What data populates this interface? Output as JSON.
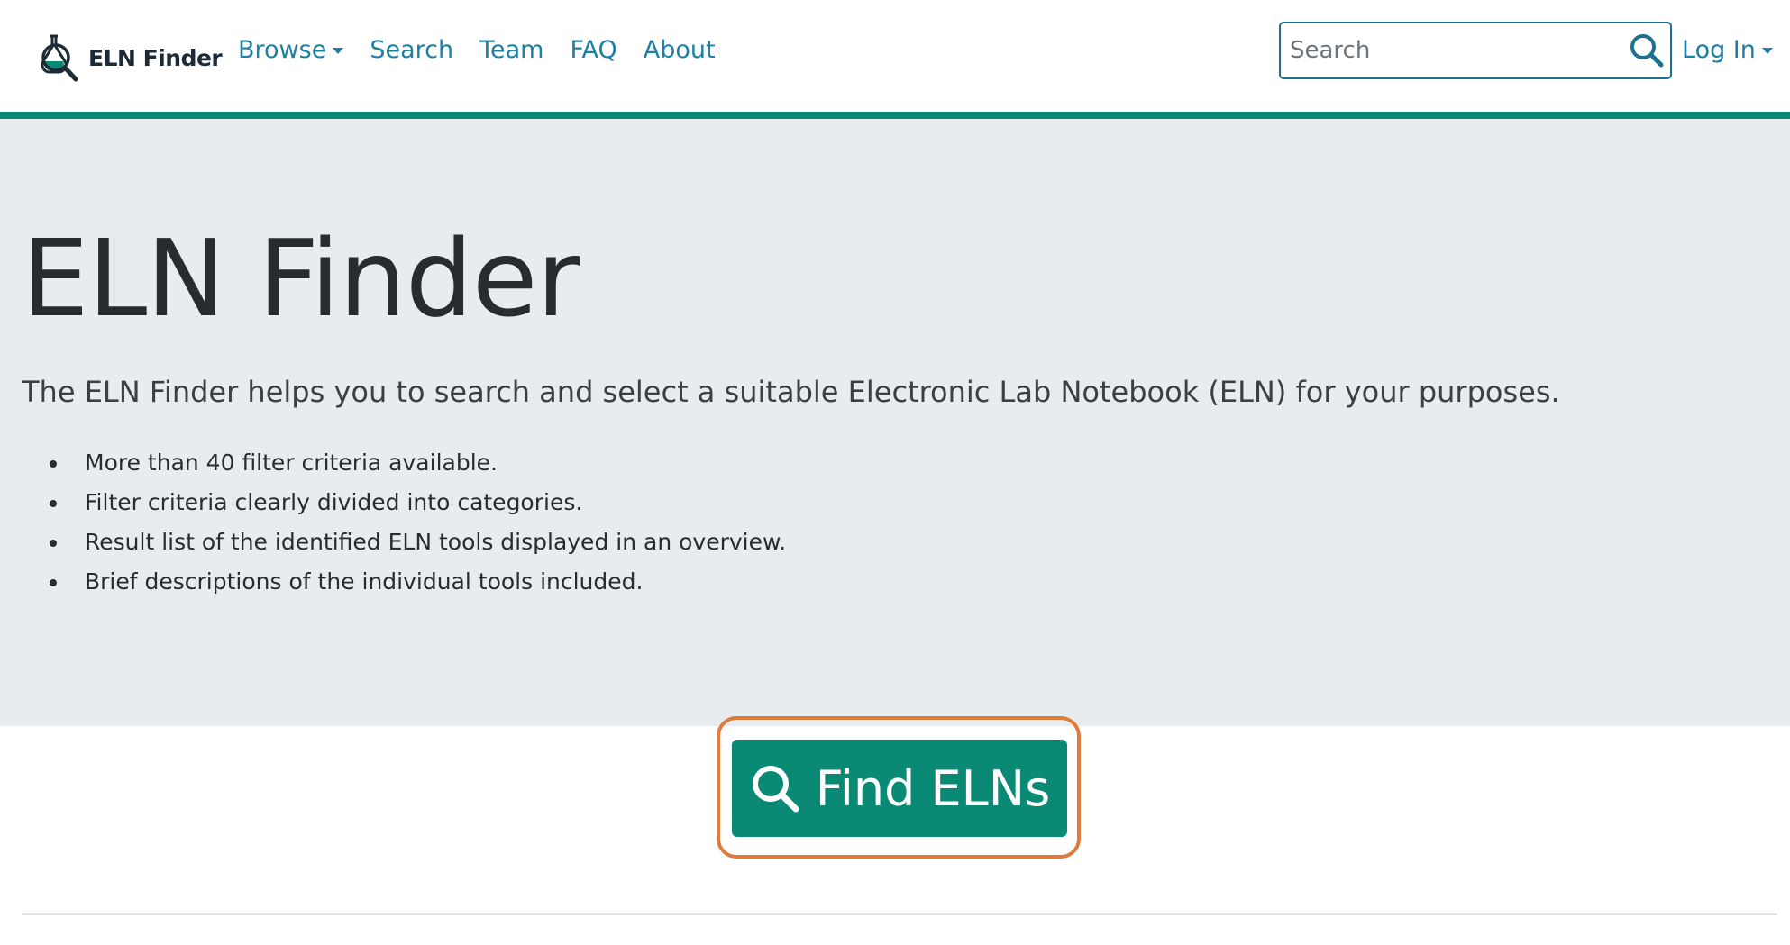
{
  "header": {
    "brand_name": "ELN Finder",
    "nav": [
      {
        "label": "Browse",
        "has_dropdown": true
      },
      {
        "label": "Search",
        "has_dropdown": false
      },
      {
        "label": "Team",
        "has_dropdown": false
      },
      {
        "label": "FAQ",
        "has_dropdown": false
      },
      {
        "label": "About",
        "has_dropdown": false
      }
    ],
    "search": {
      "placeholder": "Search",
      "value": ""
    },
    "login_label": "Log In"
  },
  "hero": {
    "title": "ELN Finder",
    "lead": "The ELN Finder helps you to search and select a suitable Electronic Lab Notebook (ELN) for your purposes.",
    "features": [
      "More than 40 filter criteria available.",
      "Filter criteria clearly divided into categories.",
      "Result list of the identified ELN tools displayed in an overview.",
      "Brief descriptions of the individual tools included."
    ]
  },
  "cta": {
    "label": "Find ELNs",
    "icon": "search-icon"
  },
  "colors": {
    "accent": "#0a8a75",
    "link": "#1f7fa3",
    "hero_bg": "#e9ecef",
    "highlight": "#e07b3a"
  }
}
